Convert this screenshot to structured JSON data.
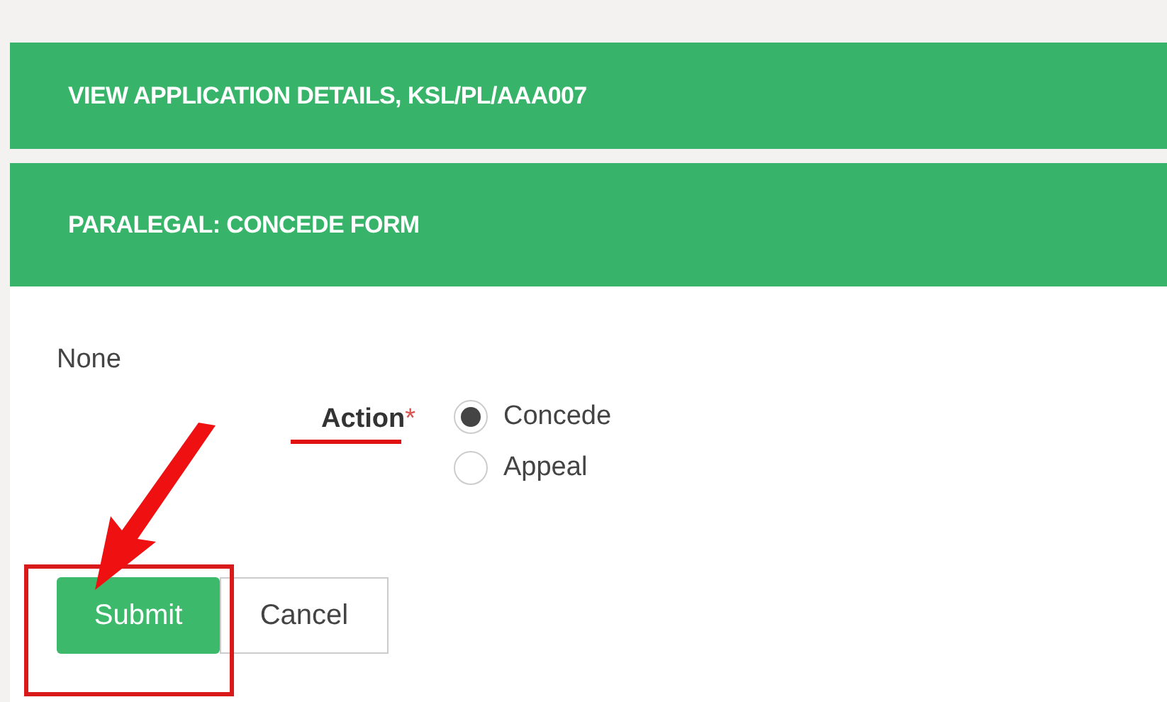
{
  "panels": [
    {
      "title": "VIEW APPLICATION DETAILS, KSL/PL/AAA007"
    },
    {
      "title": "PARALEGAL: CONCEDE FORM"
    }
  ],
  "form": {
    "note": "None",
    "field": {
      "label": "Action",
      "required_mark": "*",
      "options": [
        {
          "label": "Concede",
          "selected": true
        },
        {
          "label": "Appeal",
          "selected": false
        }
      ]
    },
    "buttons": [
      {
        "label": "Submit",
        "kind": "primary"
      },
      {
        "label": "Cancel",
        "kind": "secondary"
      }
    ]
  }
}
